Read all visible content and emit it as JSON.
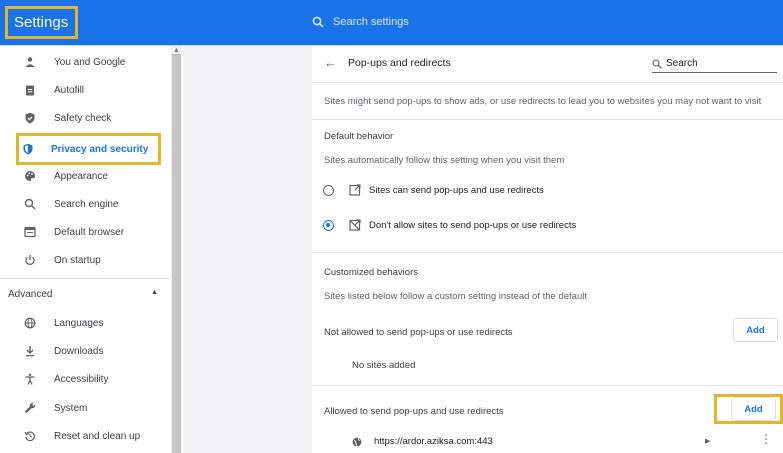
{
  "header": {
    "title": "Settings",
    "search_placeholder": "Search settings"
  },
  "sidebar": {
    "items": [
      {
        "label": "You and Google",
        "icon": "person-icon"
      },
      {
        "label": "Autofill",
        "icon": "clipboard-icon"
      },
      {
        "label": "Safety check",
        "icon": "shield-check-icon"
      },
      {
        "label": "Privacy and security",
        "icon": "shield-icon"
      },
      {
        "label": "Appearance",
        "icon": "palette-icon"
      },
      {
        "label": "Search engine",
        "icon": "search-icon"
      },
      {
        "label": "Default browser",
        "icon": "browser-icon"
      },
      {
        "label": "On startup",
        "icon": "power-icon"
      }
    ],
    "advanced_label": "Advanced",
    "advanced_items": [
      {
        "label": "Languages",
        "icon": "globe-icon"
      },
      {
        "label": "Downloads",
        "icon": "download-icon"
      },
      {
        "label": "Accessibility",
        "icon": "accessibility-icon"
      },
      {
        "label": "System",
        "icon": "wrench-icon"
      },
      {
        "label": "Reset and clean up",
        "icon": "reset-icon"
      }
    ]
  },
  "main": {
    "title": "Pop-ups and redirects",
    "search_label": "Search",
    "description": "Sites might send pop-ups to show ads, or use redirects to lead you to websites you may not want to visit",
    "default_behavior": {
      "heading": "Default behavior",
      "subtitle": "Sites automatically follow this setting when you visit them",
      "options": [
        {
          "label": "Sites can send pop-ups and use redirects",
          "selected": false
        },
        {
          "label": "Don't allow sites to send pop-ups or use redirects",
          "selected": true
        }
      ]
    },
    "customized": {
      "heading": "Customized behaviors",
      "subtitle": "Sites listed below follow a custom setting instead of the default",
      "not_allowed": {
        "label": "Not allowed to send pop-ups or use redirects",
        "add_label": "Add",
        "empty_text": "No sites added"
      },
      "allowed": {
        "label": "Allowed to send pop-ups and use redirects",
        "add_label": "Add",
        "sites": [
          "https://ardor.aziksa.com:443"
        ]
      }
    }
  },
  "colors": {
    "accent": "#1a73e8",
    "highlight": "#e5b62c"
  }
}
